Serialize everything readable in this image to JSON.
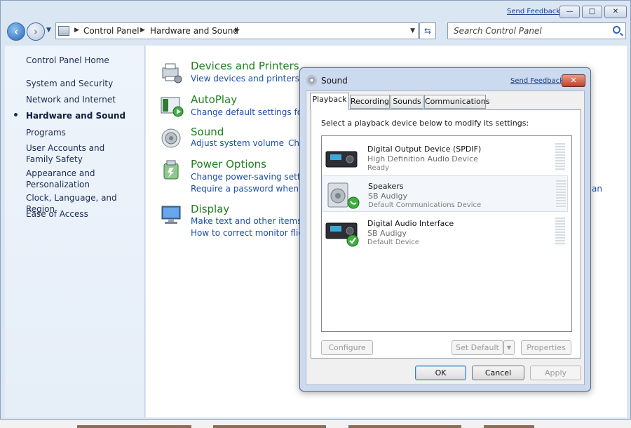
{
  "window": {
    "send_feedback": "Send Feedback",
    "min_glyph": "—",
    "max_glyph": "□",
    "close_glyph": "✕"
  },
  "address": {
    "crumbs": [
      "Control Panel",
      "Hardware and Sound"
    ],
    "search_placeholder": "Search Control Panel"
  },
  "sidebar": {
    "items": [
      {
        "label": "Control Panel Home"
      },
      {
        "label": "System and Security"
      },
      {
        "label": "Network and Internet"
      },
      {
        "label": "Hardware and Sound",
        "active": true
      },
      {
        "label": "Programs"
      },
      {
        "label": "User Accounts and Family Safety"
      },
      {
        "label": "Appearance and Personalization"
      },
      {
        "label": "Clock, Language, and Region"
      },
      {
        "label": "Ease of Access"
      }
    ]
  },
  "categories": [
    {
      "title": "Devices and Printers",
      "links": [
        "View devices and printers",
        "Ad"
      ],
      "icon": "printer-icon"
    },
    {
      "title": "AutoPlay",
      "links": [
        "Change default settings for m"
      ],
      "icon": "autoplay-icon"
    },
    {
      "title": "Sound",
      "links": [
        "Adjust system volume",
        "Ch"
      ],
      "icon": "speaker-icon"
    },
    {
      "title": "Power Options",
      "links": [
        "Change power-saving setting",
        "Require a password when the"
      ],
      "icon": "power-icon"
    },
    {
      "title": "Display",
      "links": [
        "Make text and other items larg",
        "How to correct monitor flicke"
      ],
      "icon": "monitor-icon"
    }
  ],
  "right_fragments": {
    "power_tail": "an"
  },
  "dialog": {
    "title": "Sound",
    "send_feedback": "Send Feedback",
    "close_glyph": "✕",
    "tabs": [
      "Playback",
      "Recording",
      "Sounds",
      "Communications"
    ],
    "active_tab": "Playback",
    "instruction": "Select a playback device below to modify its settings:",
    "devices": [
      {
        "name": "Digital Output Device (SPDIF)",
        "sub": "High Definition Audio Device",
        "status": "Ready",
        "icon": "receiver-icon",
        "badge": ""
      },
      {
        "name": "Speakers",
        "sub": "SB Audigy",
        "status": "Default Communications Device",
        "icon": "speakers-icon",
        "badge": "phone-badge-icon"
      },
      {
        "name": "Digital Audio Interface",
        "sub": "SB Audigy",
        "status": "Default Device",
        "icon": "receiver-icon",
        "badge": "check-badge-icon"
      }
    ],
    "buttons": {
      "configure": "Configure",
      "set_default": "Set Default",
      "set_default_arrow": "▼",
      "properties": "Properties",
      "ok": "OK",
      "cancel": "Cancel",
      "apply": "Apply"
    }
  }
}
